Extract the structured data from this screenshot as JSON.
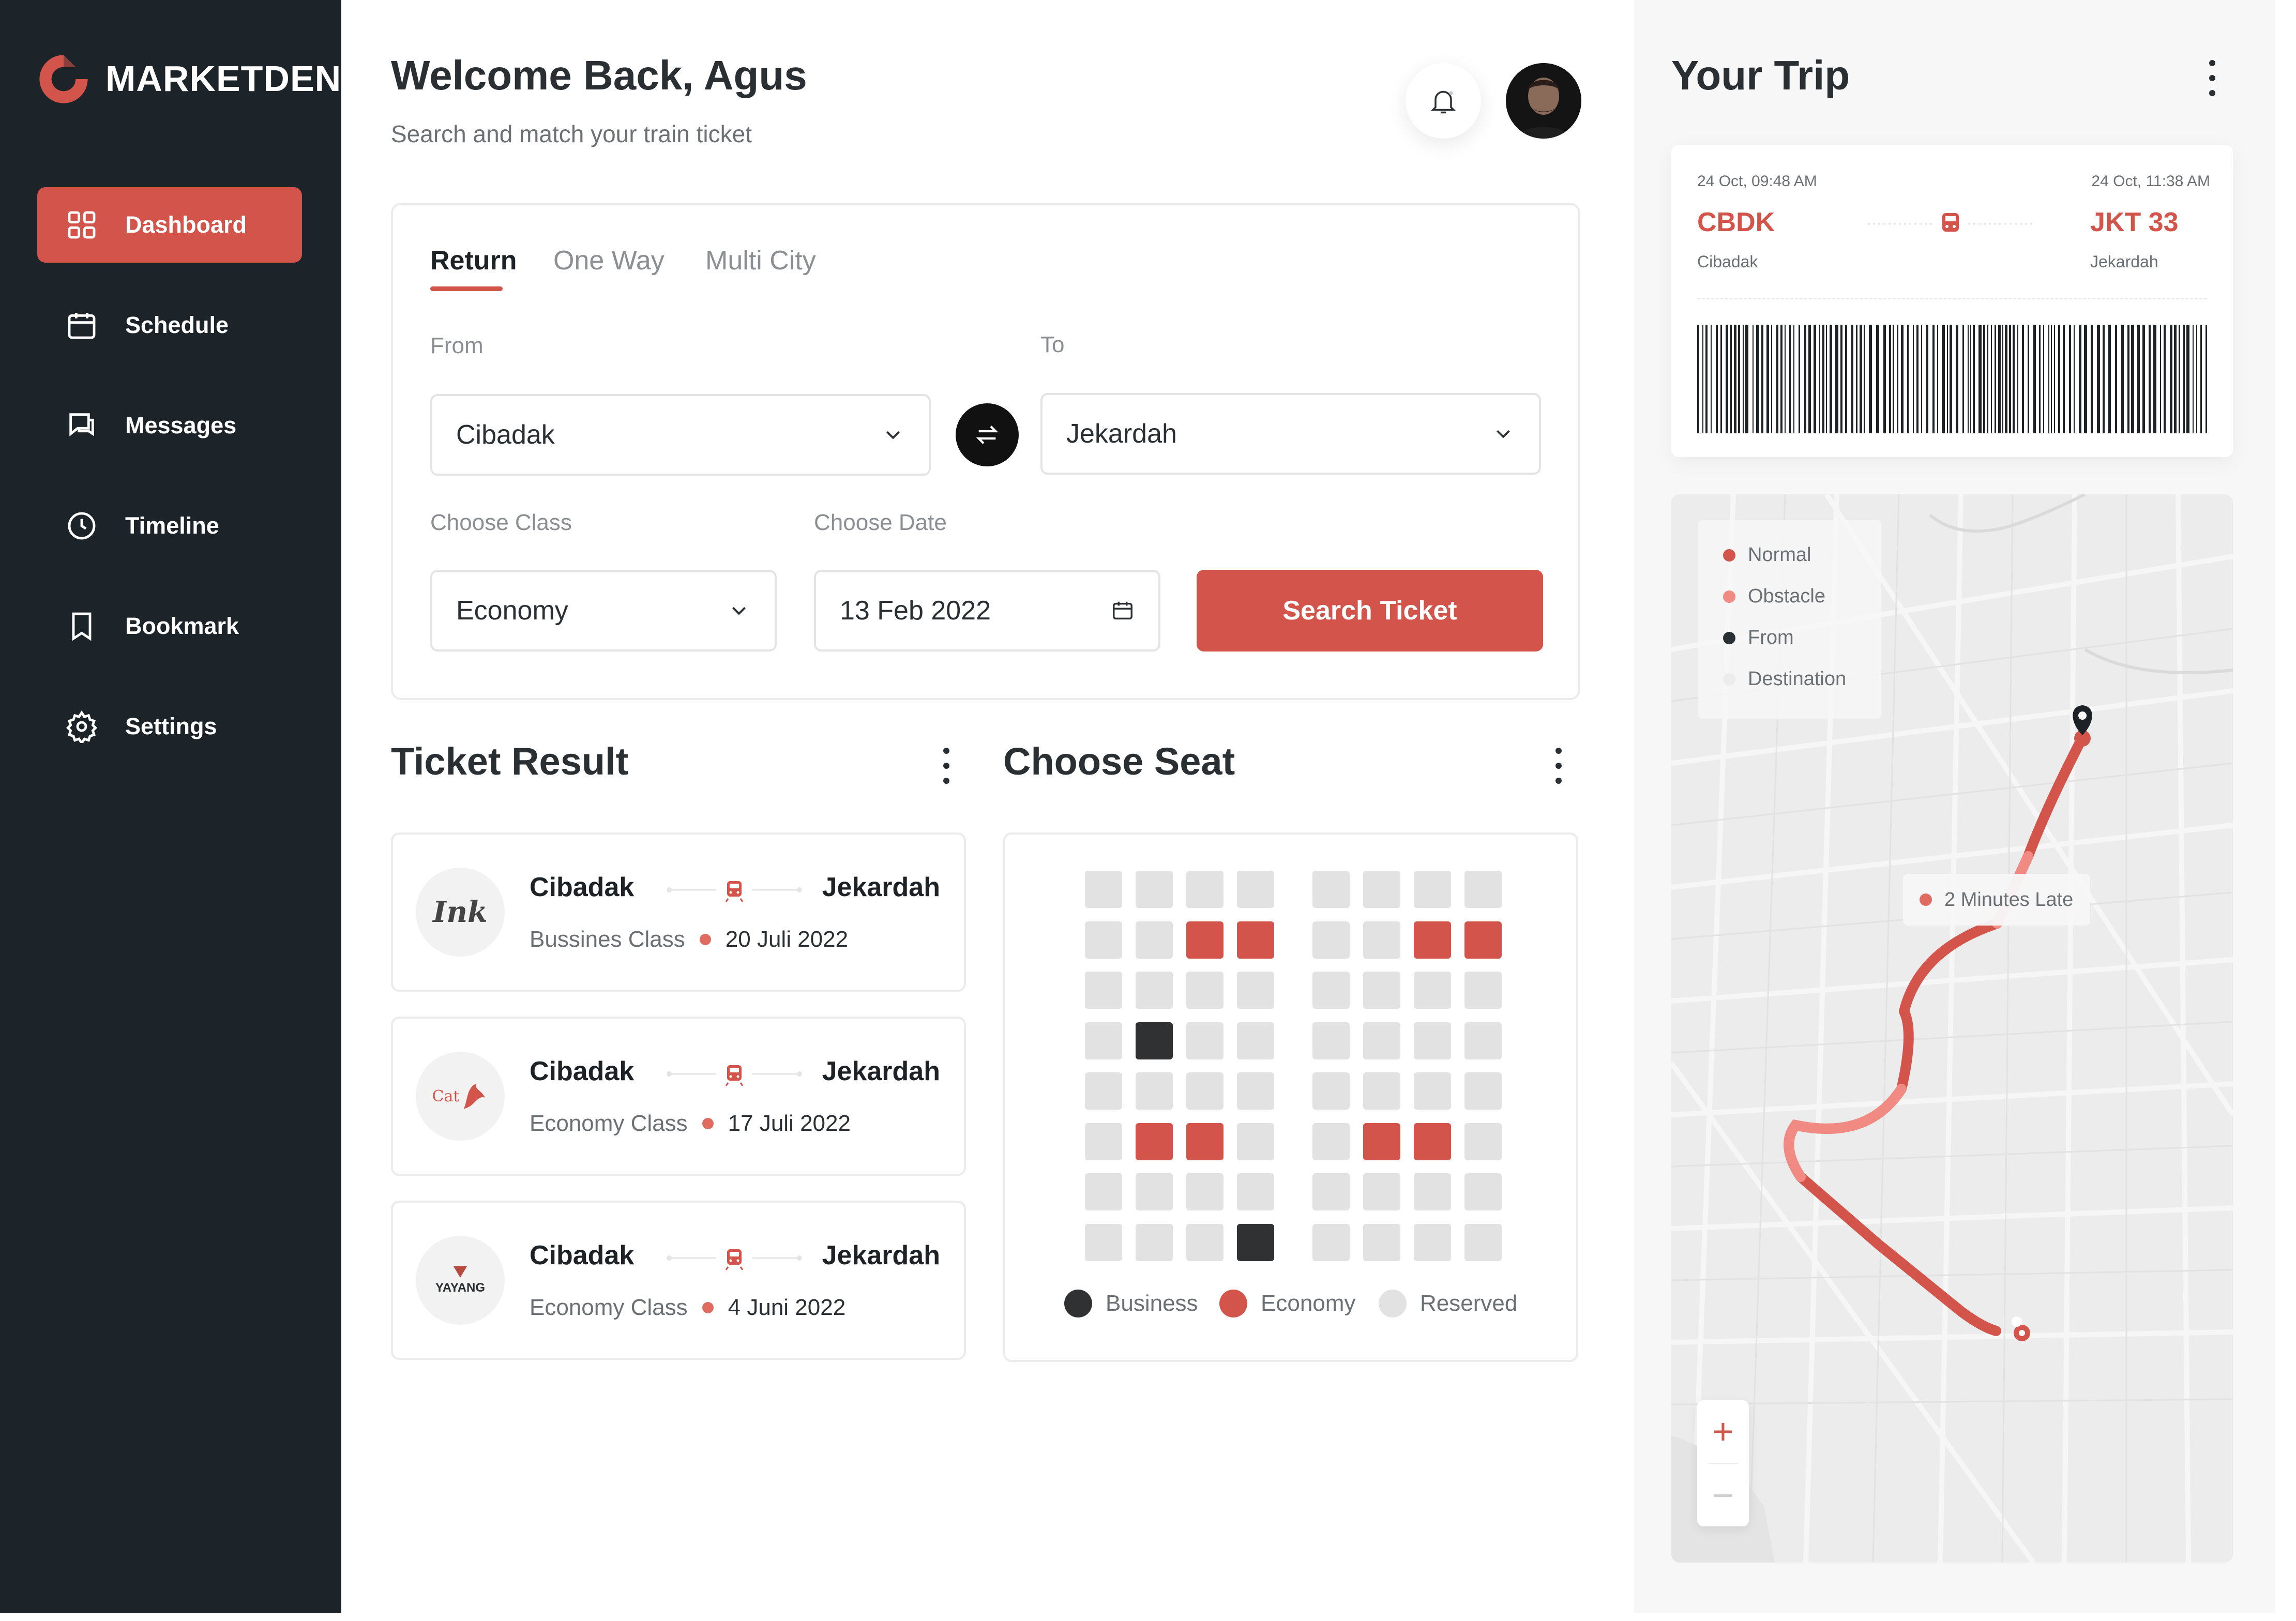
{
  "brand": {
    "name": "MARKETDEN",
    "accent": "#d2544a",
    "sidebar_bg": "#1c2429"
  },
  "sidebar": {
    "items": [
      {
        "label": "Dashboard",
        "icon": "dashboard-grid-icon",
        "active": true
      },
      {
        "label": "Schedule",
        "icon": "calendar-icon",
        "active": false
      },
      {
        "label": "Messages",
        "icon": "chat-icon",
        "active": false
      },
      {
        "label": "Timeline",
        "icon": "clock-icon",
        "active": false
      },
      {
        "label": "Bookmark",
        "icon": "bookmark-icon",
        "active": false
      },
      {
        "label": "Settings",
        "icon": "gear-icon",
        "active": false
      }
    ]
  },
  "header": {
    "title": "Welcome Back, Agus",
    "subtitle": "Search and match your train ticket"
  },
  "search": {
    "tabs": [
      "Return",
      "One Way",
      "Multi City"
    ],
    "active_tab": "Return",
    "from_label": "From",
    "from_value": "Cibadak",
    "to_label": "To",
    "to_value": "Jekardah",
    "class_label": "Choose Class",
    "class_value": "Economy",
    "date_label": "Choose Date",
    "date_value": "13 Feb 2022",
    "button": "Search Ticket"
  },
  "tickets": {
    "title": "Ticket Result",
    "items": [
      {
        "logo": "Ink",
        "from": "Cibadak",
        "to": "Jekardah",
        "class": "Bussines Class",
        "date": "20 Juli 2022"
      },
      {
        "logo": "Cat",
        "from": "Cibadak",
        "to": "Jekardah",
        "class": "Economy Class",
        "date": "17 Juli 2022"
      },
      {
        "logo": "YAYANG",
        "from": "Cibadak",
        "to": "Jekardah",
        "class": "Economy Class",
        "date": "4 Juni 2022"
      }
    ]
  },
  "seats": {
    "title": "Choose Seat",
    "legend": [
      "Business",
      "Economy",
      "Reserved"
    ],
    "colors": {
      "business": "#2f3133",
      "economy": "#d2544a",
      "reserved": "#e2e2e2"
    },
    "rows": [
      [
        "r",
        "r",
        "r",
        "r",
        "r",
        "r",
        "r",
        "r"
      ],
      [
        "r",
        "r",
        "e",
        "e",
        "r",
        "r",
        "e",
        "e"
      ],
      [
        "r",
        "r",
        "r",
        "r",
        "r",
        "r",
        "r",
        "r"
      ],
      [
        "r",
        "b",
        "r",
        "r",
        "r",
        "r",
        "r",
        "r"
      ],
      [
        "r",
        "r",
        "r",
        "r",
        "r",
        "r",
        "r",
        "r"
      ],
      [
        "r",
        "e",
        "e",
        "r",
        "r",
        "e",
        "e",
        "r"
      ],
      [
        "r",
        "r",
        "r",
        "r",
        "r",
        "r",
        "r",
        "r"
      ],
      [
        "r",
        "r",
        "r",
        "b",
        "r",
        "r",
        "r",
        "r"
      ]
    ]
  },
  "trip": {
    "title": "Your Trip",
    "depart_time": "24 Oct, 09:48 AM",
    "arrive_time": "24 Oct, 11:38 AM",
    "from_code": "CBDK",
    "to_code": "JKT 33",
    "from_city": "Cibadak",
    "to_city": "Jekardah"
  },
  "map": {
    "legend": [
      {
        "label": "Normal",
        "color": "#d2544a"
      },
      {
        "label": "Obstacle",
        "color": "#f08a82"
      },
      {
        "label": "From",
        "color": "#2a2f33"
      },
      {
        "label": "Destination",
        "color": "#ececec"
      }
    ],
    "status": "2 Minutes Late",
    "zoom_in": "+",
    "zoom_out": "−"
  }
}
